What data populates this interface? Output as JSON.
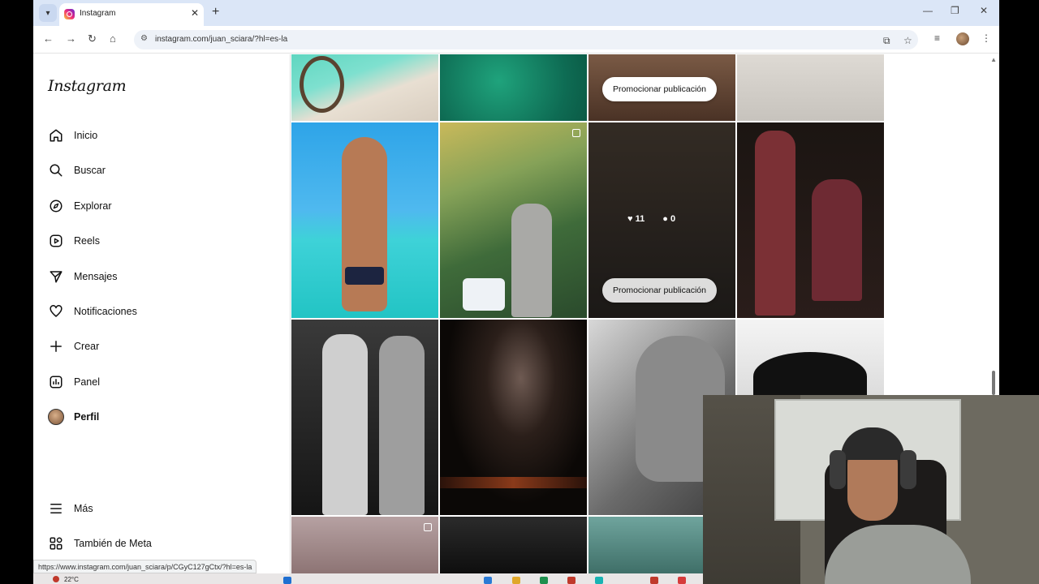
{
  "browser": {
    "tab_title": "Instagram",
    "url": "instagram.com/juan_sciara/?hl=es-la",
    "status_url": "https://www.instagram.com/juan_sciara/p/CGyC127gCtx/?hl=es-la"
  },
  "sidebar": {
    "logo": "Instagram",
    "items": [
      {
        "label": "Inicio",
        "icon": "home-icon"
      },
      {
        "label": "Buscar",
        "icon": "search-icon"
      },
      {
        "label": "Explorar",
        "icon": "compass-icon"
      },
      {
        "label": "Reels",
        "icon": "reels-icon"
      },
      {
        "label": "Mensajes",
        "icon": "messages-icon"
      },
      {
        "label": "Notificaciones",
        "icon": "heart-icon"
      },
      {
        "label": "Crear",
        "icon": "plus-icon"
      },
      {
        "label": "Panel",
        "icon": "dashboard-icon"
      },
      {
        "label": "Perfil",
        "icon": "profile-avatar"
      }
    ],
    "bottom": [
      {
        "label": "Más",
        "icon": "menu-icon"
      },
      {
        "label": "También de Meta",
        "icon": "meta-apps-icon"
      }
    ]
  },
  "grid": {
    "promote_label": "Promocionar publicación",
    "hovered_likes": "11",
    "hovered_comments": "0"
  },
  "taskbar": {
    "weather": "22°C"
  }
}
